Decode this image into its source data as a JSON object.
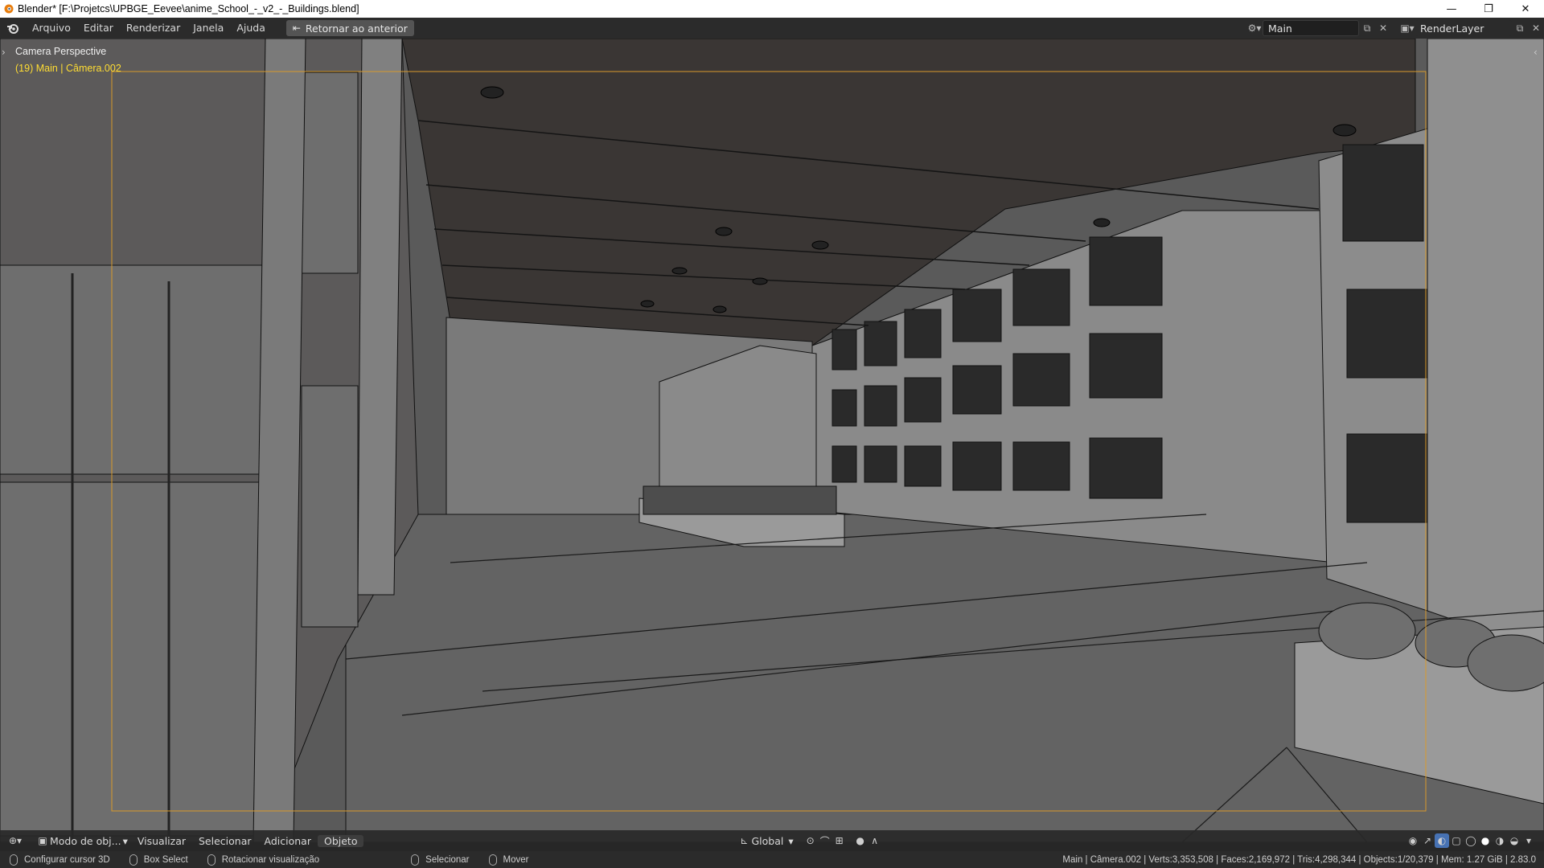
{
  "window": {
    "title": "Blender* [F:\\Projetcs\\UPBGE_Eevee\\anime_School_-_v2_-_Buildings.blend]",
    "minimize": "—",
    "maximize": "❐",
    "close": "✕"
  },
  "topbar": {
    "menus": [
      "Arquivo",
      "Editar",
      "Renderizar",
      "Janela",
      "Ajuda"
    ],
    "back_button": "Retornar ao anterior",
    "scene_name": "Main",
    "view_layer": "RenderLayer"
  },
  "viewport": {
    "view_name": "Camera Perspective",
    "camera_info": "(19) Main | Câmera.002",
    "camera_info_color": "#ffdd33",
    "camera_frame_color": "#d99a2b"
  },
  "bottom_header": {
    "mode": "Modo de obj...",
    "menus": [
      "Visualizar",
      "Selecionar",
      "Adicionar",
      "Objeto"
    ],
    "orientation": "Global"
  },
  "statusbar": {
    "hints": [
      {
        "label": "Configurar cursor 3D"
      },
      {
        "label": "Box Select"
      },
      {
        "label": "Rotacionar visualização"
      },
      {
        "label": "Selecionar"
      },
      {
        "label": "Mover"
      }
    ],
    "stats": "Main | Câmera.002 | Verts:3,353,508 | Faces:2,169,972 | Tris:4,298,344 | Objects:1/20,379 | Mem: 1.27 GiB | 2.83.0"
  }
}
